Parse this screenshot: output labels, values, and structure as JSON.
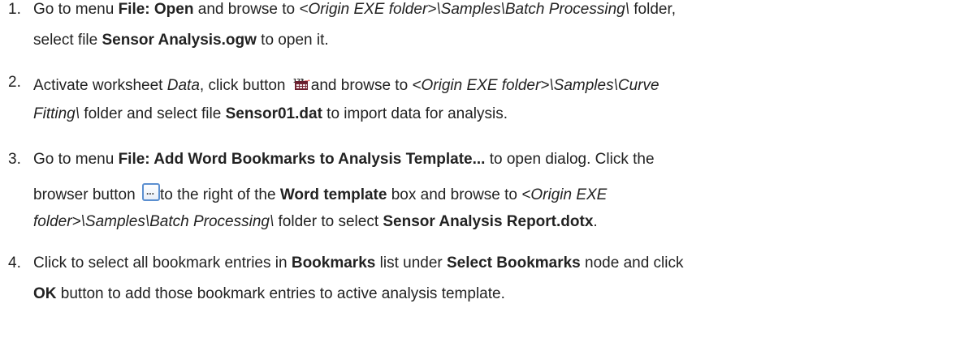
{
  "steps": [
    {
      "number": "1.",
      "lines": [
        [
          {
            "text": "Go to menu ",
            "style": "normal"
          },
          {
            "text": "File: Open",
            "style": "bold"
          },
          {
            "text": " and browse to ",
            "style": "normal"
          },
          {
            "text": "<Origin EXE folder>\\Samples\\Batch Processing\\",
            "style": "italic"
          },
          {
            "text": " folder,",
            "style": "normal"
          }
        ],
        [
          {
            "text": "select file ",
            "style": "normal"
          },
          {
            "text": "Sensor Analysis.ogw",
            "style": "bold"
          },
          {
            "text": " to open it.",
            "style": "normal"
          }
        ]
      ]
    },
    {
      "number": "2.",
      "lines": [
        [
          {
            "text": "Activate worksheet ",
            "style": "normal"
          },
          {
            "text": "Data",
            "style": "italic"
          },
          {
            "text": ", click button ",
            "style": "normal"
          },
          {
            "icon": "import-ascii-icon"
          },
          {
            "text": "and browse to ",
            "style": "normal"
          },
          {
            "text": "<Origin EXE folder>\\Samples\\Curve",
            "style": "italic"
          }
        ],
        [
          {
            "text": "Fitting\\",
            "style": "italic"
          },
          {
            "text": " folder and select file ",
            "style": "normal"
          },
          {
            "text": "Sensor01.dat",
            "style": "bold"
          },
          {
            "text": " to import data for analysis.",
            "style": "normal"
          }
        ]
      ]
    },
    {
      "number": "3.",
      "lines": [
        [
          {
            "text": "Go to menu ",
            "style": "normal"
          },
          {
            "text": "File: Add Word Bookmarks to Analysis Template...",
            "style": "bold"
          },
          {
            "text": " to open dialog. Click the",
            "style": "normal"
          }
        ],
        [
          {
            "text": "browser button ",
            "style": "normal"
          },
          {
            "icon": "browse-button-icon"
          },
          {
            "text": "to the right of the ",
            "style": "normal"
          },
          {
            "text": "Word template",
            "style": "bold"
          },
          {
            "text": " box and browse to ",
            "style": "normal"
          },
          {
            "text": "<Origin EXE",
            "style": "italic"
          }
        ],
        [
          {
            "text": "folder>\\Samples\\Batch Processing\\",
            "style": "italic"
          },
          {
            "text": " folder to select ",
            "style": "normal"
          },
          {
            "text": "Sensor Analysis Report.dotx",
            "style": "bold"
          },
          {
            "text": ".",
            "style": "normal"
          }
        ]
      ]
    },
    {
      "number": "4.",
      "lines": [
        [
          {
            "text": "Click to select all bookmark entries in ",
            "style": "normal"
          },
          {
            "text": "Bookmarks",
            "style": "bold"
          },
          {
            "text": " list under ",
            "style": "normal"
          },
          {
            "text": "Select Bookmarks",
            "style": "bold"
          },
          {
            "text": " node and click",
            "style": "normal"
          }
        ],
        [
          {
            "text": "OK",
            "style": "bold"
          },
          {
            "text": " button to add those bookmark entries to active analysis template.",
            "style": "normal"
          }
        ]
      ]
    }
  ],
  "icons": {
    "import-ascii-icon": {
      "digits": "123",
      "arrow": "→"
    }
  }
}
